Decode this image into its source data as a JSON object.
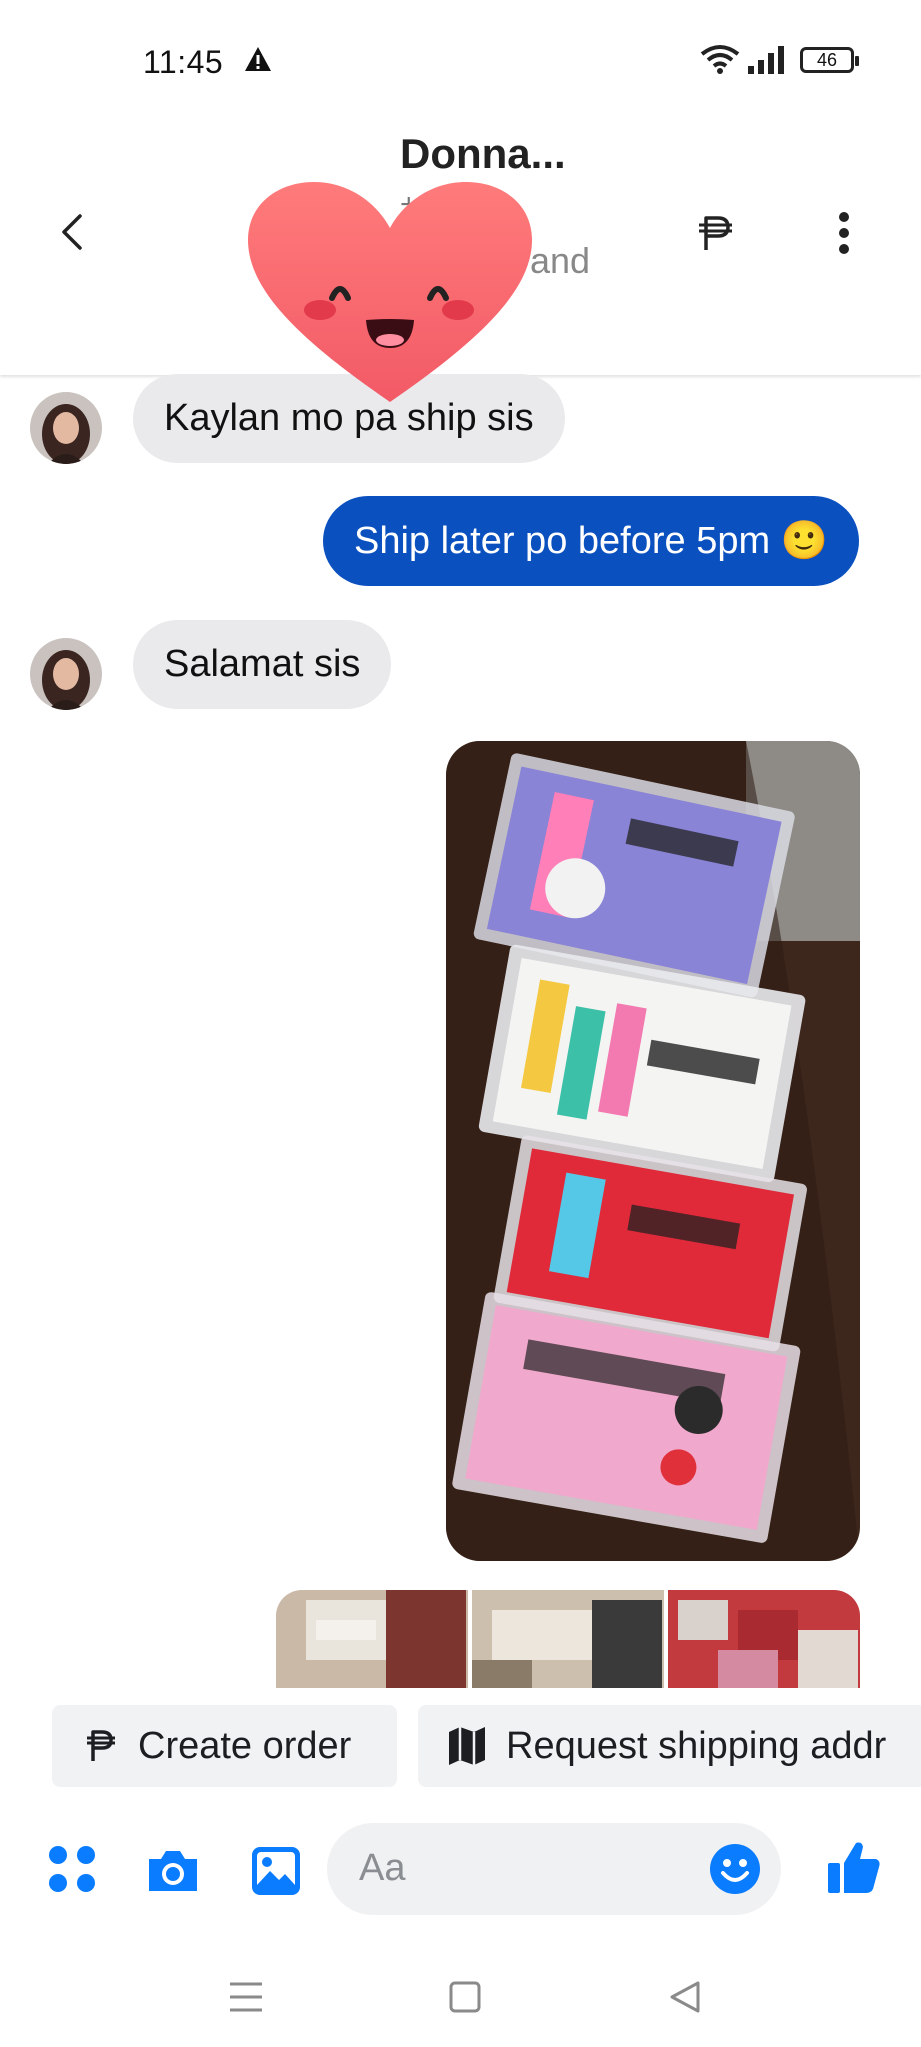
{
  "status_bar": {
    "time": "11:45",
    "battery": "46"
  },
  "header": {
    "contact_name": "Donna...",
    "sub_plus": "+",
    "sub_text": "and",
    "sub_text2": "s"
  },
  "messages": [
    {
      "direction": "in",
      "text": "Kaylan mo pa ship sis"
    },
    {
      "direction": "out",
      "text": "Ship later po before 5pm 🙂"
    },
    {
      "direction": "in",
      "text": "Salamat sis"
    }
  ],
  "quick_actions": {
    "create_order": "Create order",
    "request_shipping": "Request shipping addr"
  },
  "composer": {
    "placeholder": "Aa"
  },
  "colors": {
    "messenger_blue": "#0a7cff",
    "outgoing_bubble": "#0b50bf",
    "incoming_bubble": "#eaeaec"
  }
}
